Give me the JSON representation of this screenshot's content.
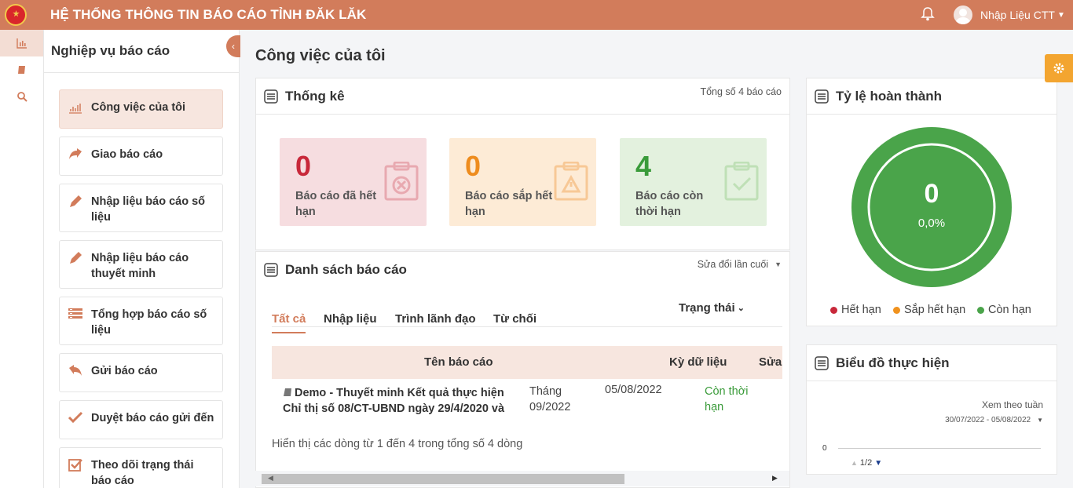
{
  "header": {
    "title": "HỆ THỐNG THÔNG TIN BÁO CÁO TỈNH ĐĂK LĂK",
    "user_name": "Nhập Liệu CTT"
  },
  "sidebar": {
    "title": "Nghiệp vụ báo cáo",
    "items": [
      {
        "label": "Công việc của tôi",
        "icon": "chart-icon"
      },
      {
        "label": "Giao báo cáo",
        "icon": "share-icon"
      },
      {
        "label": "Nhập liệu báo cáo số liệu",
        "icon": "pencil-icon"
      },
      {
        "label": "Nhập liệu báo cáo thuyết minh",
        "icon": "pencil-icon"
      },
      {
        "label": "Tổng hợp báo cáo số liệu",
        "icon": "list-icon"
      },
      {
        "label": "Gửi báo cáo",
        "icon": "reply-icon"
      },
      {
        "label": "Duyệt báo cáo gửi đến",
        "icon": "check-icon"
      },
      {
        "label": "Theo dõi trạng thái báo cáo",
        "icon": "checkbox-icon"
      }
    ]
  },
  "main": {
    "page_title": "Công việc của tôi"
  },
  "stats": {
    "title": "Thống kê",
    "total_text": "Tổng số 4 báo cáo",
    "cards": [
      {
        "value": "0",
        "label": "Báo cáo đã hết hạn",
        "color": "#c8283a",
        "bg": "#f6dde0"
      },
      {
        "value": "0",
        "label": "Báo cáo sắp hết hạn",
        "color": "#ee8c1e",
        "bg": "#fdebd6"
      },
      {
        "value": "4",
        "label": "Báo cáo còn thời hạn",
        "color": "#3a9b3a",
        "bg": "#e3f1de"
      }
    ]
  },
  "reports": {
    "title": "Danh sách báo cáo",
    "sort_label": "Sửa đổi lần cuối",
    "tabs": [
      "Tất cả",
      "Nhập liệu",
      "Trình lãnh đạo",
      "Từ chối"
    ],
    "status_filter": "Trạng thái",
    "columns": [
      "Tên báo cáo",
      "Kỳ dữ liệu",
      "Sửa"
    ],
    "rows": [
      {
        "name": "Demo - Thuyết minh Kết quả thực hiện Chỉ thị số 08/CT-UBND ngày 29/4/2020 và",
        "period": "Tháng 09/2022",
        "date": "05/08/2022",
        "status": "Còn thời hạn"
      }
    ],
    "footer": "Hiển thị các dòng từ 1 đến 4 trong tổng số 4 dòng"
  },
  "completion": {
    "title": "Tỷ lệ hoàn thành",
    "value": "0",
    "percent": "0,0%",
    "legend": [
      {
        "label": "Hết hạn",
        "color": "#c8283a"
      },
      {
        "label": "Sắp hết hạn",
        "color": "#f0921e"
      },
      {
        "label": "Còn hạn",
        "color": "#4aa44a"
      }
    ]
  },
  "progress": {
    "title": "Biểu đồ thực hiện",
    "view_label": "Xem theo tuần",
    "date_range": "30/07/2022 - 05/08/2022",
    "axis_zero": "0",
    "pager": "1/2"
  }
}
